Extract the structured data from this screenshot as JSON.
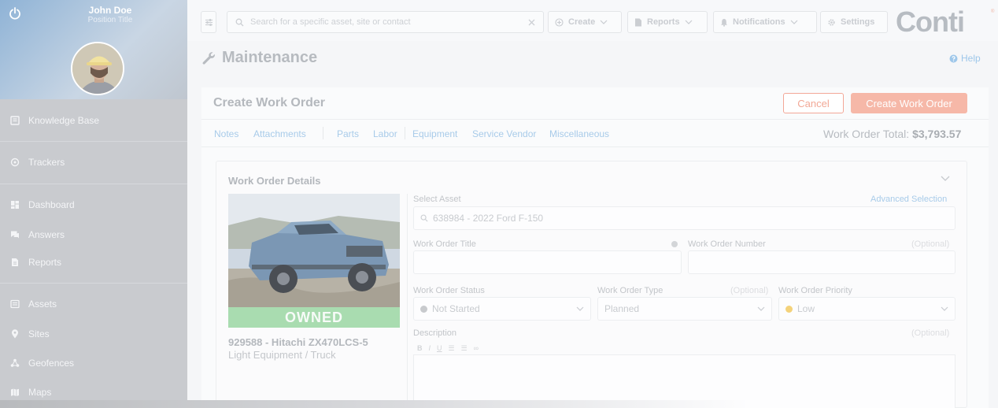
{
  "user": {
    "name": "John Doe",
    "position": "Position Title"
  },
  "sidebar": {
    "items": [
      {
        "label": "Knowledge Base",
        "icon": "book-icon"
      },
      {
        "label": "Trackers",
        "icon": "target-icon"
      },
      {
        "label": "Dashboard",
        "icon": "dashboard-icon"
      },
      {
        "label": "Answers",
        "icon": "chat-icon"
      },
      {
        "label": "Reports",
        "icon": "report-icon"
      },
      {
        "label": "Assets",
        "icon": "assets-icon"
      },
      {
        "label": "Sites",
        "icon": "pin-icon"
      },
      {
        "label": "Geofences",
        "icon": "geofence-icon"
      },
      {
        "label": "Maps",
        "icon": "map-icon"
      }
    ]
  },
  "topbar": {
    "search_placeholder": "Search for a specific asset, site or contact",
    "create_label": "Create",
    "reports_label": "Reports",
    "notifications_label": "Notifications",
    "settings_label": "Settings",
    "logo_text": "Conti",
    "logo_mark": "®"
  },
  "page": {
    "title": "Maintenance",
    "help_label": "Help"
  },
  "work_order": {
    "title": "Create Work Order",
    "cancel_label": "Cancel",
    "create_label": "Create Work Order",
    "tabs": [
      "Notes",
      "Attachments",
      "Parts",
      "Labor",
      "Equipment",
      "Service Vendor",
      "Miscellaneous"
    ],
    "total_label": "Work Order Total:",
    "total_value": "$3,793.57"
  },
  "details": {
    "title": "Work Order Details",
    "owned_label": "OWNED",
    "asset_name": "929588 - Hitachi ZX470LCS-5",
    "asset_type": "Light Equipment / Truck",
    "select_asset_label": "Select Asset",
    "advanced_selection_label": "Advanced Selection",
    "select_asset_value": "638984 - 2022 Ford F-150",
    "title_label": "Work Order Title",
    "number_label": "Work Order Number",
    "optional_label": "(Optional)",
    "status_label": "Work Order Status",
    "status_value": "Not Started",
    "type_label": "Work Order Type",
    "type_value": "Planned",
    "priority_label": "Work Order Priority",
    "priority_value": "Low",
    "description_label": "Description",
    "colors": {
      "status_dot": "#c8cacd",
      "priority_dot": "#f4d27a",
      "accent": "#f6b8a8",
      "link": "#a8cbe9"
    }
  }
}
